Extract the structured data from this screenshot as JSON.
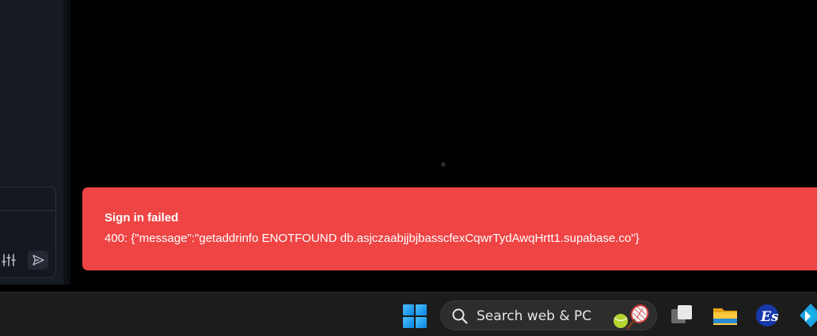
{
  "toast": {
    "title": "Sign in failed",
    "message": "400: {\"message\":\"getaddrinfo ENOTFOUND db.asjczaabjjbjbasscfexCqwrTydAwqHrtt1.supabase.co\"}",
    "color": "#ef4444"
  },
  "chat": {
    "tools_icon": "sliders-icon",
    "send_icon": "send-icon"
  },
  "taskbar": {
    "search_placeholder": "Search web & PC",
    "icons": [
      "windows-start-icon",
      "search-icon",
      "tennis-highlight-icon",
      "task-view-icon",
      "file-explorer-icon",
      "es-app-icon",
      "kodi-icon"
    ]
  }
}
